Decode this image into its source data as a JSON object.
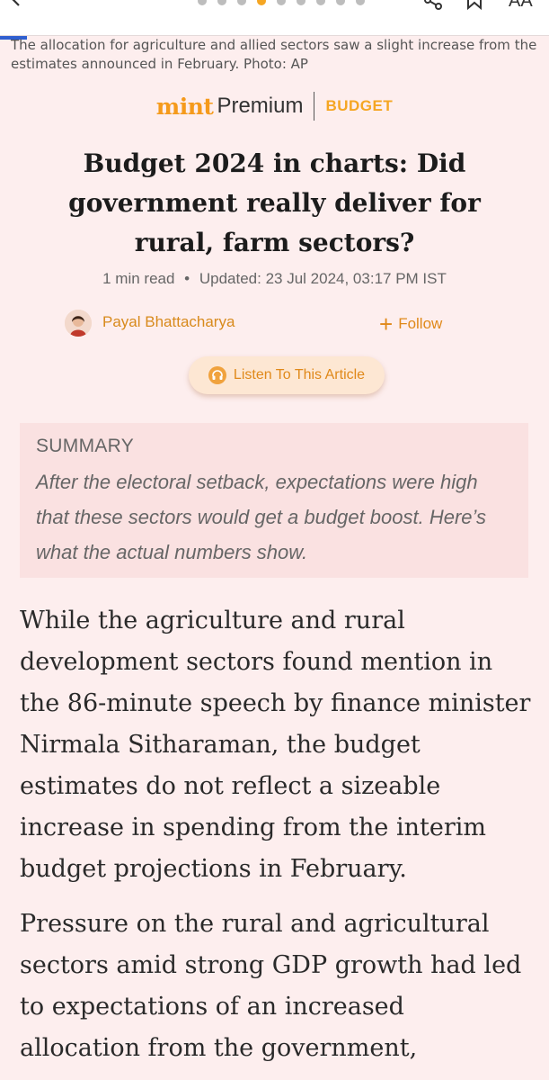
{
  "caption": "The allocation for agriculture and allied sectors saw a slight increase from the estimates announced in February. Photo: AP",
  "brand": {
    "logo": "mint",
    "premium": "Premium",
    "section": "BUDGET"
  },
  "article": {
    "headline": "Budget 2024 in charts: Did government really deliver for rural, farm sectors?",
    "read_time": "1 min read",
    "separator": "•",
    "updated": "Updated: 23 Jul 2024, 03:17 PM IST",
    "author": "Payal Bhattacharya",
    "follow_label": "Follow",
    "listen_label": "Listen To This Article"
  },
  "summary": {
    "label": "SUMMARY",
    "text": "After the electoral setback, expectations were high that these sectors would get a budget boost. Here’s what the actual numbers show."
  },
  "body": {
    "p1": "While the agriculture and rural development sectors found mention in the 86-minute speech by finance minister Nirmala Sitharaman, the budget estimates do not reflect a sizeable increase in spending from the interim budget projections in February.",
    "p2": "Pressure on the rural and agricultural sectors amid strong GDP growth had led to expectations of an increased allocation from the government,"
  },
  "colors": {
    "background": "#fdeeee",
    "accent": "#f59a1b",
    "summary_bg": "#fae1e1",
    "progress": "#2f5fd0"
  },
  "icons": [
    "back-icon",
    "share-icon",
    "bookmark-icon",
    "text-size-icon",
    "plus-icon",
    "headphones-icon"
  ]
}
